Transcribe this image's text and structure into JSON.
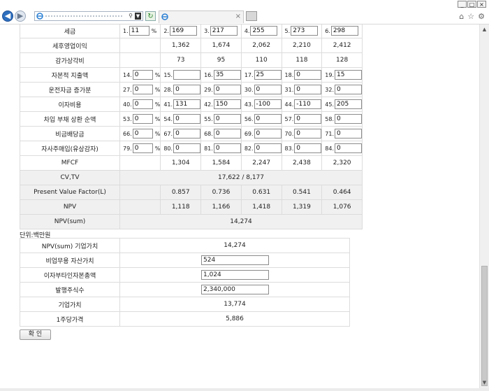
{
  "browser": {
    "window_buttons": [
      "_",
      "□",
      "×"
    ],
    "tab_close": "×",
    "refresh_glyph": "↻",
    "back_glyph": "◀",
    "forward_glyph": "▶",
    "tools": [
      "⌂",
      "☆",
      "⚙"
    ]
  },
  "main_rows": [
    {
      "label": "세금",
      "cells": [
        {
          "idx": "1.",
          "value": "11",
          "pct": "%",
          "w": "narrow"
        },
        {
          "idx": "2.",
          "value": "169",
          "w": "wide"
        },
        {
          "idx": "3.",
          "value": "217",
          "w": "wide"
        },
        {
          "idx": "4.",
          "value": "255",
          "w": "wide"
        },
        {
          "idx": "5.",
          "value": "273",
          "w": "wide"
        },
        {
          "idx": "6.",
          "value": "298",
          "w": "wide"
        }
      ]
    },
    {
      "label": "세후영업이익",
      "cells": [
        {
          "text": ""
        },
        {
          "text": "1,362"
        },
        {
          "text": "1,674"
        },
        {
          "text": "2,062"
        },
        {
          "text": "2,210"
        },
        {
          "text": "2,412"
        }
      ]
    },
    {
      "label": "감가상각비",
      "cells": [
        {
          "text": ""
        },
        {
          "text": "73"
        },
        {
          "text": "95"
        },
        {
          "text": "110"
        },
        {
          "text": "118"
        },
        {
          "text": "128"
        }
      ]
    },
    {
      "label": "자본적 지출액",
      "cells": [
        {
          "idx": "14.",
          "value": "0",
          "pct": "%",
          "w": "narrow"
        },
        {
          "idx": "15.",
          "value": "",
          "w": "wide"
        },
        {
          "idx": "16.",
          "value": "35",
          "w": "wide"
        },
        {
          "idx": "17.",
          "value": "25",
          "w": "wide"
        },
        {
          "idx": "18.",
          "value": "0",
          "w": "wide"
        },
        {
          "idx": "19.",
          "value": "15",
          "w": "wide"
        }
      ]
    },
    {
      "label": "운전자금 증가분",
      "cells": [
        {
          "idx": "27.",
          "value": "0",
          "pct": "%",
          "w": "narrow"
        },
        {
          "idx": "28.",
          "value": "0",
          "w": "wide"
        },
        {
          "idx": "29.",
          "value": "0",
          "w": "wide"
        },
        {
          "idx": "30.",
          "value": "0",
          "w": "wide"
        },
        {
          "idx": "31.",
          "value": "0",
          "w": "wide"
        },
        {
          "idx": "32.",
          "value": "0",
          "w": "wide"
        }
      ]
    },
    {
      "label": "이자비용",
      "cells": [
        {
          "idx": "40.",
          "value": "0",
          "pct": "%",
          "w": "narrow"
        },
        {
          "idx": "41.",
          "value": "131",
          "w": "wide"
        },
        {
          "idx": "42.",
          "value": "150",
          "w": "wide"
        },
        {
          "idx": "43.",
          "value": "-100",
          "w": "wide"
        },
        {
          "idx": "44.",
          "value": "-110",
          "w": "wide"
        },
        {
          "idx": "45.",
          "value": "205",
          "w": "wide"
        }
      ]
    },
    {
      "label": "차입 부채 상환 순액",
      "cells": [
        {
          "idx": "53.",
          "value": "0",
          "pct": "%",
          "w": "narrow"
        },
        {
          "idx": "54.",
          "value": "0",
          "w": "wide"
        },
        {
          "idx": "55.",
          "value": "0",
          "w": "wide"
        },
        {
          "idx": "56.",
          "value": "0",
          "w": "wide"
        },
        {
          "idx": "57.",
          "value": "0",
          "w": "wide"
        },
        {
          "idx": "58.",
          "value": "0",
          "w": "wide"
        }
      ]
    },
    {
      "label": "비금배당금",
      "cells": [
        {
          "idx": "66.",
          "value": "0",
          "pct": "%",
          "w": "narrow"
        },
        {
          "idx": "67.",
          "value": "0",
          "w": "wide"
        },
        {
          "idx": "68.",
          "value": "0",
          "w": "wide"
        },
        {
          "idx": "69.",
          "value": "0",
          "w": "wide"
        },
        {
          "idx": "70.",
          "value": "0",
          "w": "wide"
        },
        {
          "idx": "71.",
          "value": "0",
          "w": "wide"
        }
      ]
    },
    {
      "label": "자사주매입(유상감자)",
      "cells": [
        {
          "idx": "79.",
          "value": "0",
          "pct": "%",
          "w": "narrow"
        },
        {
          "idx": "80.",
          "value": "0",
          "w": "wide"
        },
        {
          "idx": "81.",
          "value": "0",
          "w": "wide"
        },
        {
          "idx": "82.",
          "value": "0",
          "w": "wide"
        },
        {
          "idx": "83.",
          "value": "0",
          "w": "wide"
        },
        {
          "idx": "84.",
          "value": "0",
          "w": "wide"
        }
      ]
    },
    {
      "label": "MFCF",
      "cells": [
        {
          "text": ""
        },
        {
          "text": "1,304"
        },
        {
          "text": "1,584"
        },
        {
          "text": "2,247"
        },
        {
          "text": "2,438"
        },
        {
          "text": "2,320"
        }
      ]
    },
    {
      "label": "CV,TV",
      "gray": true,
      "span_text": "17,622 / 8,177"
    },
    {
      "label": "Present Value Factor(L)",
      "gray": true,
      "cells": [
        {
          "text": ""
        },
        {
          "text": "0.857"
        },
        {
          "text": "0.736"
        },
        {
          "text": "0.631"
        },
        {
          "text": "0.541"
        },
        {
          "text": "0.464"
        }
      ]
    },
    {
      "label": "NPV",
      "gray": true,
      "cells": [
        {
          "text": ""
        },
        {
          "text": "1,118"
        },
        {
          "text": "1,166"
        },
        {
          "text": "1,418"
        },
        {
          "text": "1,319"
        },
        {
          "text": "1,076"
        }
      ]
    },
    {
      "label": "NPV(sum)",
      "gray": true,
      "span_text": "14,274"
    }
  ],
  "unit_label": "단위:백만원",
  "summary_rows": [
    {
      "label": "NPV(sum) 기업가치",
      "text": "14,274"
    },
    {
      "label": "비업무용 자산가치",
      "input": "524"
    },
    {
      "label": "이자부타인자본총액",
      "input": "1,024"
    },
    {
      "label": "발행주식수",
      "input": "2,340,000"
    },
    {
      "label": "기업가치",
      "text": "13,774"
    },
    {
      "label": "1주당가격",
      "text": "5,886"
    }
  ],
  "confirm_button": "확 인",
  "colors": {
    "gray_row": "#f0f0f0",
    "border": "#dcdcdc"
  }
}
